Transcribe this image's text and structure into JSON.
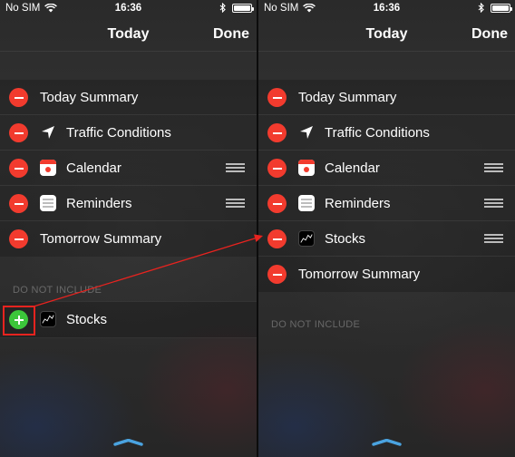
{
  "screens": [
    {
      "status": {
        "carrier": "No SIM",
        "time": "16:36"
      },
      "nav": {
        "title": "Today",
        "done": "Done"
      },
      "included": [
        {
          "label": "Today Summary",
          "icon": null,
          "reorder": false
        },
        {
          "label": "Traffic Conditions",
          "icon": "location-arrow-icon",
          "reorder": false
        },
        {
          "label": "Calendar",
          "icon": "calendar-icon",
          "reorder": true
        },
        {
          "label": "Reminders",
          "icon": "reminders-icon",
          "reorder": true
        },
        {
          "label": "Tomorrow Summary",
          "icon": null,
          "reorder": false
        }
      ],
      "section_header": "DO NOT INCLUDE",
      "excluded": [
        {
          "label": "Stocks",
          "icon": "stocks-icon"
        }
      ]
    },
    {
      "status": {
        "carrier": "No SIM",
        "time": "16:36"
      },
      "nav": {
        "title": "Today",
        "done": "Done"
      },
      "included": [
        {
          "label": "Today Summary",
          "icon": null,
          "reorder": false
        },
        {
          "label": "Traffic Conditions",
          "icon": "location-arrow-icon",
          "reorder": false
        },
        {
          "label": "Calendar",
          "icon": "calendar-icon",
          "reorder": true
        },
        {
          "label": "Reminders",
          "icon": "reminders-icon",
          "reorder": true
        },
        {
          "label": "Stocks",
          "icon": "stocks-icon",
          "reorder": true
        },
        {
          "label": "Tomorrow Summary",
          "icon": null,
          "reorder": false
        }
      ],
      "section_header": "DO NOT INCLUDE",
      "excluded": []
    }
  ],
  "colors": {
    "delete": "#f23b2e",
    "add": "#3cc63a",
    "annotation": "#e8231f",
    "grabber": "#4aa3e0"
  }
}
